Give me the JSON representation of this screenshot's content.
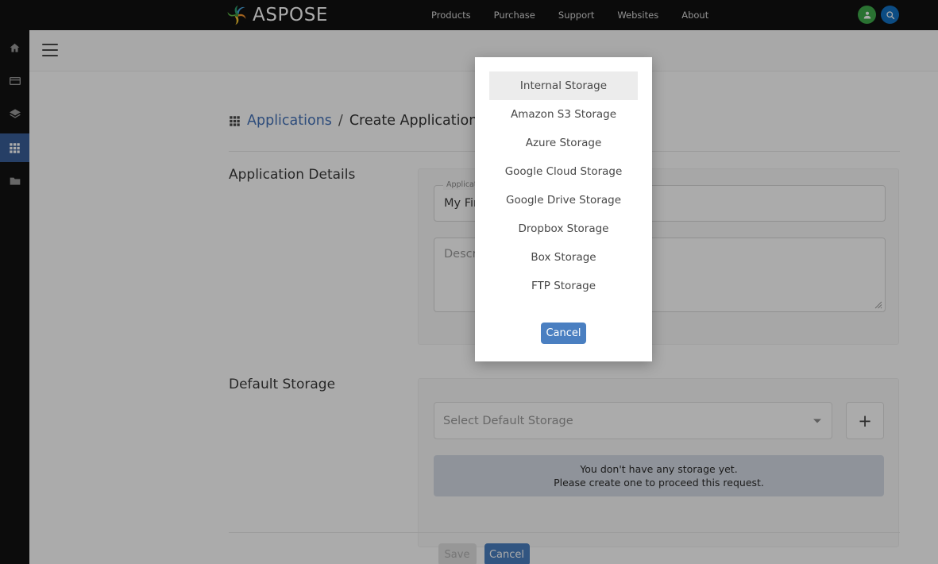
{
  "topbar": {
    "brand_name": "ASPOSE",
    "logo_icon": "aspose-spiral-logo",
    "nav": [
      {
        "label": "Products"
      },
      {
        "label": "Purchase"
      },
      {
        "label": "Support"
      },
      {
        "label": "Websites"
      },
      {
        "label": "About"
      }
    ],
    "account_icon": "user-icon",
    "search_icon": "search-icon",
    "account_color": "#3faa4b",
    "search_color": "#1272c4"
  },
  "sidebar": {
    "items": [
      {
        "icon": "home-icon",
        "active": false
      },
      {
        "icon": "credit-card-icon",
        "active": false
      },
      {
        "icon": "layers-icon",
        "active": false
      },
      {
        "icon": "grid-apps-icon",
        "active": true
      },
      {
        "icon": "folder-icon",
        "active": false
      }
    ],
    "active_color": "#3a5e99"
  },
  "subbar": {
    "menu_toggle_icon": "hamburger-menu-icon"
  },
  "breadcrumb": {
    "icon": "grid-apps-icon",
    "parent": "Applications",
    "separator": "/",
    "current": "Create Application",
    "link_color": "#4472b8"
  },
  "application_details": {
    "section_title": "Application Details",
    "name_field": {
      "label": "Application Name",
      "value": "My First App"
    },
    "description_field": {
      "placeholder": "Description"
    }
  },
  "default_storage": {
    "section_title": "Default Storage",
    "select_placeholder": "Select Default Storage",
    "dropdown_icon": "chevron-down-icon",
    "add_button_label": "+",
    "alert_line1": "You don't have any storage yet.",
    "alert_line2": "Please create one to proceed this request.",
    "alert_color": "#d6dce6"
  },
  "footer": {
    "save_label": "Save",
    "save_disabled": true,
    "cancel_label": "Cancel"
  },
  "modal": {
    "options": [
      {
        "label": "Internal Storage",
        "selected": true
      },
      {
        "label": "Amazon S3 Storage",
        "selected": false
      },
      {
        "label": "Azure Storage",
        "selected": false
      },
      {
        "label": "Google Cloud Storage",
        "selected": false
      },
      {
        "label": "Google Drive Storage",
        "selected": false
      },
      {
        "label": "Dropbox Storage",
        "selected": false
      },
      {
        "label": "Box Storage",
        "selected": false
      },
      {
        "label": "FTP Storage",
        "selected": false
      }
    ],
    "cancel_label": "Cancel",
    "primary_color": "#4a7fc1"
  }
}
